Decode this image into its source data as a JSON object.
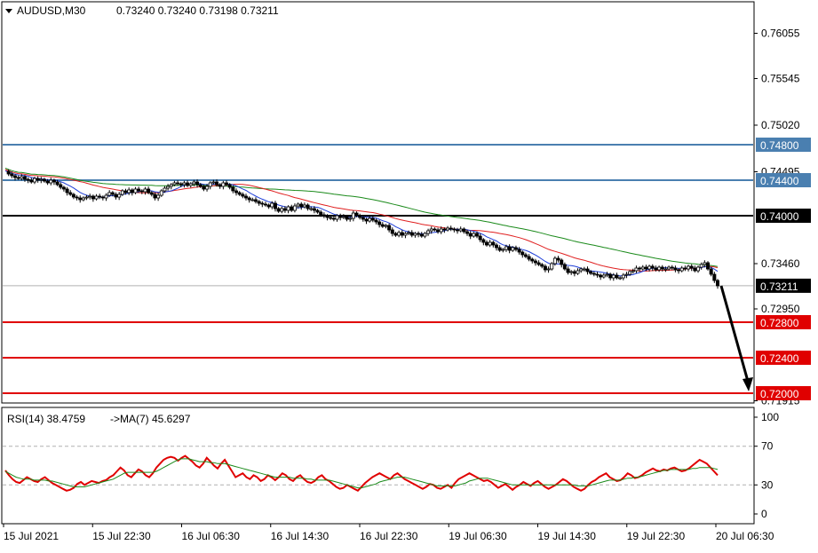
{
  "header": {
    "symbol": "AUDUSD,M30",
    "ohlc": "0.73240 0.73240 0.73198 0.73211",
    "rsi_label": "RSI(14) 38.4759",
    "ma_label": "->MA(7) 45.6297"
  },
  "colors": {
    "background": "#ffffff",
    "frame": "#000000",
    "candle": "#000000",
    "ma_fast": "#1f3fd8",
    "ma_mid": "#e02020",
    "ma_slow": "#1a8a1a",
    "support_line": "#e00000",
    "resistance_line": "#4a7fb0",
    "pivot_line": "#000000",
    "current_price_line": "#b0b0b0",
    "rsi_line": "#e00000",
    "rsi_ma_line": "#1a8a1a",
    "arrow": "#000000"
  },
  "chart_data": [
    {
      "type": "candlestick",
      "title": "AUDUSD,M30",
      "y_tick_labels": [
        "0.76055",
        "0.75545",
        "0.75020",
        "0.74495",
        "0.73460",
        "0.72950",
        "0.71915"
      ],
      "price_tags": [
        {
          "label": "0.74800",
          "role": "resistance",
          "value": 0.748
        },
        {
          "label": "0.74400",
          "role": "resistance",
          "value": 0.744
        },
        {
          "label": "0.74000",
          "role": "pivot",
          "value": 0.74
        },
        {
          "label": "0.73211",
          "role": "current",
          "value": 0.73211
        },
        {
          "label": "0.72800",
          "role": "support",
          "value": 0.728
        },
        {
          "label": "0.72400",
          "role": "support",
          "value": 0.724
        },
        {
          "label": "0.72000",
          "role": "support",
          "value": 0.72
        }
      ],
      "x_tick_labels": [
        "15 Jul 2021",
        "15 Jul 22:30",
        "16 Jul 06:30",
        "16 Jul 14:30",
        "16 Jul 22:30",
        "19 Jul 06:30",
        "19 Jul 14:30",
        "19 Jul 22:30",
        "20 Jul 06:30"
      ],
      "close_series": [
        0.745,
        0.7447,
        0.7445,
        0.7443,
        0.7442,
        0.7444,
        0.7441,
        0.744,
        0.7438,
        0.7442,
        0.744,
        0.7441,
        0.7439,
        0.7437,
        0.744,
        0.7438,
        0.7435,
        0.7432,
        0.743,
        0.7426,
        0.7424,
        0.7421,
        0.742,
        0.7418,
        0.742,
        0.7421,
        0.7422,
        0.7419,
        0.7422,
        0.7421,
        0.742,
        0.7423,
        0.7426,
        0.7424,
        0.7421,
        0.7424,
        0.7428,
        0.7426,
        0.7429,
        0.7426,
        0.743,
        0.7428,
        0.7427,
        0.743,
        0.7426,
        0.7424,
        0.742,
        0.7423,
        0.7428,
        0.7431,
        0.7433,
        0.7435,
        0.7437,
        0.7436,
        0.7435,
        0.7437,
        0.7434,
        0.7436,
        0.7438,
        0.7435,
        0.7433,
        0.743,
        0.7433,
        0.7437,
        0.7438,
        0.7435,
        0.7433,
        0.7437,
        0.7435,
        0.7432,
        0.7428,
        0.7426,
        0.7424,
        0.7422,
        0.742,
        0.7418,
        0.7418,
        0.7416,
        0.7414,
        0.7413,
        0.7412,
        0.741,
        0.7414,
        0.7408,
        0.7405,
        0.7408,
        0.7406,
        0.741,
        0.7406,
        0.7411,
        0.7413,
        0.741,
        0.7412,
        0.7408,
        0.7408,
        0.7406,
        0.7404,
        0.7401,
        0.74,
        0.7398,
        0.7397,
        0.7396,
        0.74,
        0.7398,
        0.7399,
        0.7396,
        0.7397,
        0.7403,
        0.74,
        0.7398,
        0.7396,
        0.7394,
        0.7397,
        0.7395,
        0.7393,
        0.739,
        0.7388,
        0.7389,
        0.7384,
        0.738,
        0.7378,
        0.7381,
        0.7378,
        0.738,
        0.7381,
        0.7378,
        0.738,
        0.7379,
        0.7377,
        0.738,
        0.7383,
        0.7385,
        0.7384,
        0.7382,
        0.7385,
        0.7384,
        0.7386,
        0.7385,
        0.7384,
        0.7383,
        0.7385,
        0.7382,
        0.738,
        0.7377,
        0.738,
        0.7377,
        0.7373,
        0.737,
        0.7367,
        0.737,
        0.7367,
        0.7364,
        0.7361,
        0.7362,
        0.7365,
        0.7361,
        0.7364,
        0.7362,
        0.7359,
        0.7356,
        0.7354,
        0.7351,
        0.7349,
        0.7347,
        0.7345,
        0.7343,
        0.7339,
        0.734,
        0.7346,
        0.7352,
        0.735,
        0.7345,
        0.734,
        0.7336,
        0.7337,
        0.7335,
        0.7338,
        0.734,
        0.734,
        0.7337,
        0.7335,
        0.7334,
        0.7333,
        0.7331,
        0.7333,
        0.7334,
        0.733,
        0.7333,
        0.733,
        0.733,
        0.7333,
        0.7334,
        0.7337,
        0.7338,
        0.7341,
        0.734,
        0.7342,
        0.734,
        0.7343,
        0.7341,
        0.7339,
        0.7342,
        0.734,
        0.734,
        0.7342,
        0.7341,
        0.7339,
        0.7338,
        0.7341,
        0.734,
        0.7343,
        0.7341,
        0.7338,
        0.7342,
        0.7345,
        0.7347,
        0.734,
        0.7334,
        0.7327,
        0.7321
      ],
      "support_levels": [
        0.728,
        0.724,
        0.72
      ],
      "resistance_levels": [
        0.748,
        0.744
      ],
      "pivot_level": 0.74,
      "current_price": 0.73211,
      "arrow_target": 0.72,
      "ylim": [
        0.719,
        0.764
      ]
    },
    {
      "type": "line",
      "title": "RSI(14) 38.4759 ->MA(7) 45.6297",
      "y_tick_labels": [
        "100",
        "70",
        "30",
        "0"
      ],
      "levels": [
        70,
        30
      ],
      "ylim": [
        0,
        100
      ],
      "series": [
        {
          "name": "RSI(14)",
          "values": [
            45,
            40,
            36,
            33,
            32,
            35,
            38,
            36,
            34,
            33,
            36,
            38,
            35,
            32,
            30,
            28,
            26,
            24,
            25,
            27,
            31,
            33,
            30,
            32,
            34,
            33,
            32,
            34,
            35,
            38,
            40,
            44,
            48,
            45,
            40,
            38,
            42,
            46,
            44,
            40,
            38,
            42,
            48,
            52,
            56,
            58,
            59,
            58,
            55,
            58,
            60,
            57,
            54,
            50,
            48,
            52,
            58,
            54,
            50,
            47,
            52,
            56,
            50,
            44,
            38,
            40,
            42,
            38,
            36,
            40,
            38,
            34,
            36,
            40,
            38,
            35,
            38,
            42,
            40,
            36,
            34,
            38,
            40,
            36,
            33,
            32,
            34,
            38,
            40,
            36,
            34,
            31,
            28,
            26,
            27,
            30,
            28,
            26,
            24,
            28,
            32,
            35,
            38,
            40,
            42,
            40,
            38,
            36,
            40,
            42,
            39,
            36,
            34,
            32,
            30,
            28,
            26,
            28,
            31,
            30,
            27,
            26,
            28,
            30,
            27,
            32,
            36,
            38,
            40,
            42,
            40,
            38,
            36,
            34,
            35,
            33,
            30,
            27,
            29,
            31,
            28,
            25,
            28,
            30,
            33,
            31,
            29,
            32,
            34,
            31,
            28,
            26,
            28,
            30,
            33,
            36,
            34,
            31,
            28,
            26,
            24,
            26,
            30,
            33,
            35,
            38,
            40,
            42,
            38,
            36,
            34,
            35,
            38,
            42,
            40,
            37,
            38,
            40,
            43,
            45,
            47,
            45,
            44,
            46,
            45,
            47,
            48,
            46,
            44,
            45,
            47,
            50,
            53,
            56,
            54,
            52,
            48,
            44,
            40
          ],
          "color": "#e00000"
        },
        {
          "name": "MA(7)",
          "values": [
            44,
            42,
            40,
            38,
            37,
            36,
            36,
            36,
            35,
            35,
            35,
            35,
            34,
            34,
            33,
            32,
            31,
            30,
            29,
            28,
            28,
            28,
            28,
            29,
            30,
            31,
            32,
            33,
            34,
            35,
            36,
            38,
            40,
            42,
            43,
            43,
            43,
            43,
            43,
            43,
            43,
            43,
            44,
            46,
            48,
            50,
            52,
            54,
            56,
            57,
            57,
            57,
            56,
            55,
            54,
            54,
            54,
            53,
            53,
            52,
            52,
            52,
            51,
            50,
            49,
            48,
            47,
            46,
            45,
            44,
            43,
            42,
            41,
            40,
            39,
            38,
            38,
            38,
            38,
            38,
            37,
            37,
            37,
            37,
            36,
            36,
            35,
            35,
            35,
            35,
            35,
            34,
            33,
            32,
            31,
            30,
            29,
            28,
            27,
            27,
            28,
            29,
            30,
            31,
            33,
            34,
            35,
            36,
            37,
            38,
            38,
            38,
            37,
            36,
            35,
            34,
            33,
            32,
            31,
            30,
            29,
            29,
            29,
            29,
            29,
            29,
            30,
            31,
            32,
            34,
            35,
            36,
            37,
            37,
            37,
            36,
            35,
            34,
            33,
            32,
            31,
            30,
            30,
            30,
            30,
            30,
            30,
            30,
            30,
            30,
            30,
            30,
            30,
            30,
            30,
            30,
            30,
            30,
            30,
            29,
            29,
            29,
            29,
            30,
            31,
            32,
            33,
            34,
            35,
            35,
            35,
            35,
            36,
            37,
            37,
            38,
            38,
            39,
            40,
            41,
            42,
            43,
            44,
            45,
            45,
            46,
            46,
            46,
            46,
            46,
            46,
            47,
            47,
            48,
            48,
            48,
            48,
            47,
            46
          ],
          "color": "#1a8a1a"
        }
      ]
    }
  ]
}
